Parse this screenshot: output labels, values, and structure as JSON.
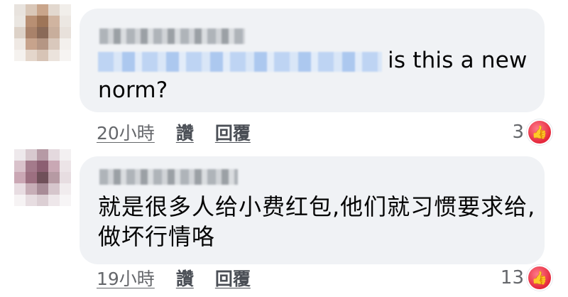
{
  "comments": [
    {
      "text_suffix": "is this a new norm?",
      "time": "20小時",
      "like_label": "讚",
      "reply_label": "回覆",
      "reaction_count": "3"
    },
    {
      "text": "就是很多人给小费红包,他们就习惯要求给,做坏行情咯",
      "time": "19小時",
      "like_label": "讚",
      "reply_label": "回覆",
      "reaction_count": "13"
    }
  ],
  "colors": {
    "bubble": "#f0f2f5",
    "text": "#050505",
    "meta": "#65676b",
    "reaction": "#e5283b"
  },
  "icons": {
    "reaction": "love-reaction-icon"
  }
}
